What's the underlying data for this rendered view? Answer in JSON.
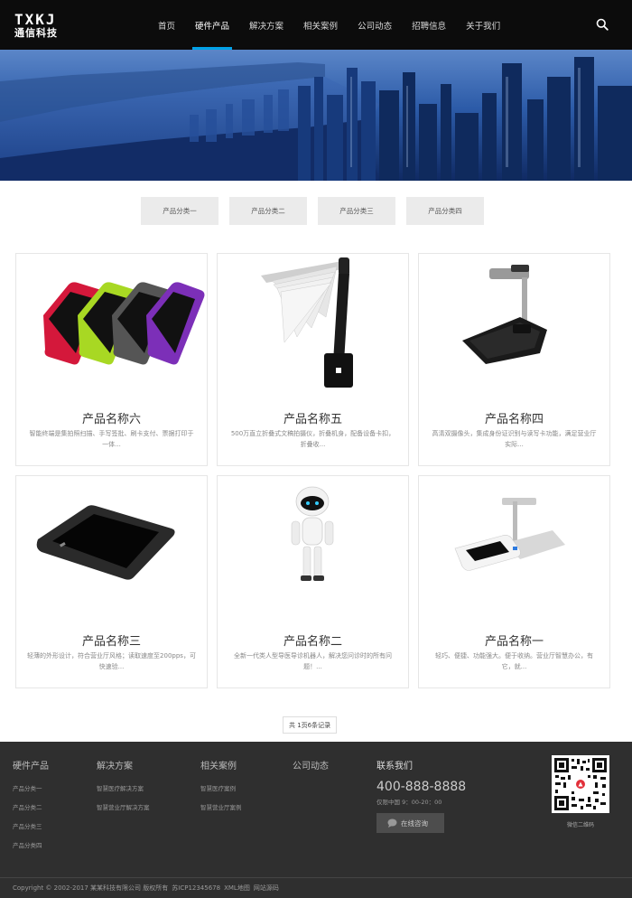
{
  "header": {
    "logo_top": "TXKJ",
    "logo_bottom": "通信科技",
    "nav": [
      "首页",
      "硬件产品",
      "解决方案",
      "相关案例",
      "公司动态",
      "招聘信息",
      "关于我们"
    ],
    "active_nav": "硬件产品",
    "search_icon": "search-icon"
  },
  "categories": [
    "产品分类一",
    "产品分类二",
    "产品分类三",
    "产品分类四"
  ],
  "products": [
    {
      "name": "产品名称六",
      "desc": "智能终端是集拍照扫描、手写签批、刷卡支付、票据打印于一体...",
      "image": "payment-terminals"
    },
    {
      "name": "产品名称五",
      "desc": "500万直立折叠式文稿拍摄仪，折叠机身，配备设备卡扣，折叠收...",
      "image": "document-scanner"
    },
    {
      "name": "产品名称四",
      "desc": "高清双摄像头，集成身份证识别与读写卡功能，满足营业厅实际...",
      "image": "document-camera"
    },
    {
      "name": "产品名称三",
      "desc": "轻薄的外形设计，符合营业厅风格；读取速度至200pps，可快速验...",
      "image": "signature-tablet"
    },
    {
      "name": "产品名称二",
      "desc": "全新一代类人型导医导诊机器人，解决您问诊时的所有问题！...",
      "image": "service-robot"
    },
    {
      "name": "产品名称一",
      "desc": "轻巧、便捷、功能强大。便于收纳。营业厅智慧办公，有它，就...",
      "image": "id-reader-station"
    }
  ],
  "pagination": "共 1页6条记录",
  "footer": {
    "columns": [
      {
        "title": "硬件产品",
        "links": [
          "产品分类一",
          "产品分类二",
          "产品分类三",
          "产品分类四"
        ]
      },
      {
        "title": "解决方案",
        "links": [
          "智慧医疗解决方案",
          "智慧营业厅解决方案"
        ]
      },
      {
        "title": "相关案例",
        "links": [
          "智慧医疗案例",
          "智慧营业厅案例"
        ]
      },
      {
        "title": "公司动态",
        "links": []
      }
    ],
    "contact_title": "联系我们",
    "phone": "400-888-8888",
    "hours": "仅限中国 9：00-20：00",
    "chat_label": "在线咨询",
    "qr_label": "微信二维码",
    "copyright": [
      "Copyright © 2002-2017 某某科技有限公司 版权所有",
      "苏ICP12345678",
      "XML地图",
      "网站源码"
    ]
  }
}
